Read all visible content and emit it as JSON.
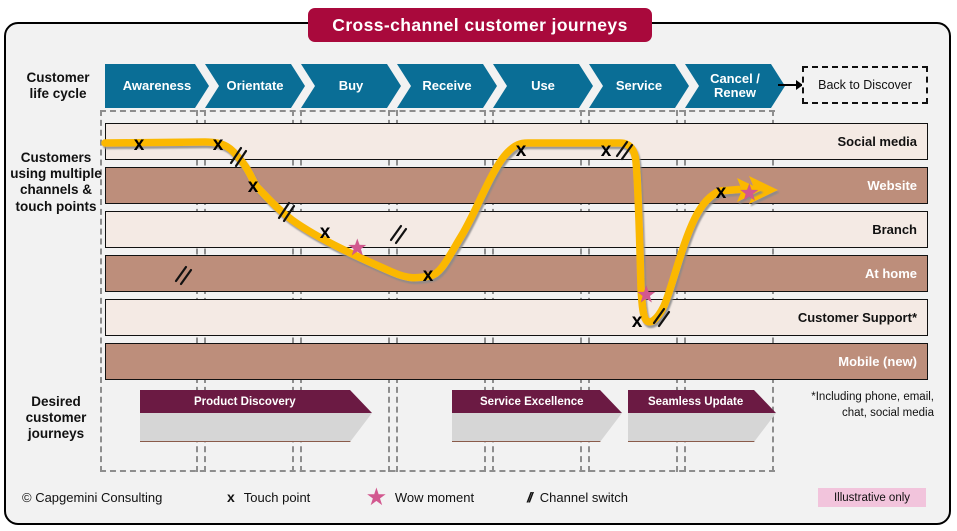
{
  "title": "Cross-channel  customer journeys",
  "lifecycle": {
    "label_line1": "Customer",
    "label_line2": "life cycle",
    "stages": [
      {
        "label": "Awareness"
      },
      {
        "label": "Orientate"
      },
      {
        "label": "Buy"
      },
      {
        "label": "Receive"
      },
      {
        "label": "Use"
      },
      {
        "label": "Service"
      },
      {
        "label": "Cancel /\nRenew"
      }
    ],
    "back_box": "Back to Discover"
  },
  "channels": {
    "label": "Customers using multiple channels & touch points",
    "rows": [
      {
        "name": "Social media",
        "tone": "light"
      },
      {
        "name": "Website",
        "tone": "dark"
      },
      {
        "name": "Branch",
        "tone": "light"
      },
      {
        "name": "At home",
        "tone": "dark"
      },
      {
        "name": "Customer Support*",
        "tone": "light"
      },
      {
        "name": "Mobile (new)",
        "tone": "dark"
      }
    ]
  },
  "journeys": {
    "label": "Desired customer journeys",
    "banners": [
      {
        "label": "Product Discovery"
      },
      {
        "label": "Service Excellence"
      },
      {
        "label": "Seamless Update"
      }
    ],
    "footnote": "*Including phone, email, chat, social media"
  },
  "legend": {
    "copyright": "© Capgemini Consulting",
    "items": [
      {
        "glyph": "x",
        "label": "Touch point",
        "icon": "cross-icon"
      },
      {
        "glyph": "★",
        "label": "Wow moment",
        "icon": "star-icon"
      },
      {
        "glyph": "//",
        "label": "Channel switch",
        "icon": "slash-icon"
      }
    ],
    "badge": "Illustrative only"
  },
  "colors": {
    "title_bg": "#a9093c",
    "chevron": "#0a6e96",
    "row_dark": "#bd8e7b",
    "row_light": "#f4eae4",
    "journey_line": "#fbb800",
    "wow_star": "#d2588f",
    "banner_header": "#6b1a43",
    "badge_bg": "#f2c4dc"
  }
}
